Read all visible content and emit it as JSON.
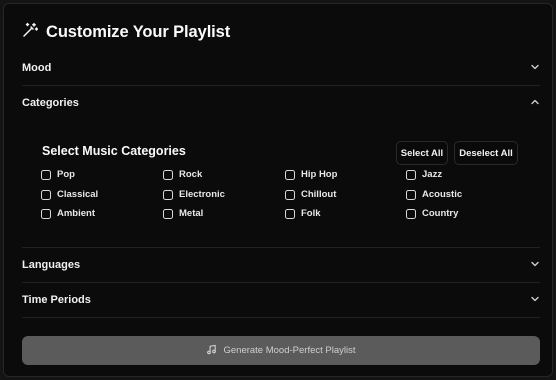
{
  "header": {
    "title": "Customize Your Playlist",
    "icon": "magic-wand-icon"
  },
  "sections": {
    "mood": "Mood",
    "categories": "Categories",
    "languages": "Languages",
    "time_periods": "Time Periods"
  },
  "categories_panel": {
    "title": "Select Music Categories",
    "select_all": "Select All",
    "deselect_all": "Deselect All",
    "items": [
      {
        "label": "Pop",
        "checked": false
      },
      {
        "label": "Rock",
        "checked": false
      },
      {
        "label": "Hip Hop",
        "checked": false
      },
      {
        "label": "Jazz",
        "checked": false
      },
      {
        "label": "Classical",
        "checked": false
      },
      {
        "label": "Electronic",
        "checked": false
      },
      {
        "label": "Chillout",
        "checked": false
      },
      {
        "label": "Acoustic",
        "checked": false
      },
      {
        "label": "Ambient",
        "checked": false
      },
      {
        "label": "Metal",
        "checked": false
      },
      {
        "label": "Folk",
        "checked": false
      },
      {
        "label": "Country",
        "checked": false
      }
    ]
  },
  "generate_button": {
    "label": "Generate Mood-Perfect Playlist",
    "icon": "music-note-icon"
  },
  "colors": {
    "background": "#0b0b0b",
    "button_disabled": "#5b5b5b",
    "text": "#f2f2f2"
  }
}
